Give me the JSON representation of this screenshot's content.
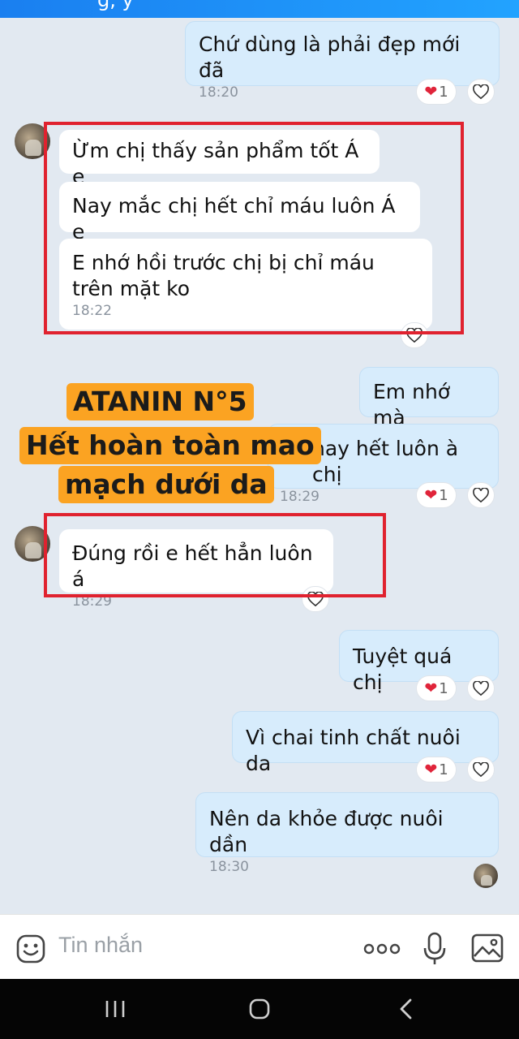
{
  "header": {
    "title_fragment": "g, y"
  },
  "messages": [
    {
      "text": "Chứ dùng là phải đẹp mới đã",
      "time": "18:20",
      "reaction_count": "1"
    },
    {
      "text": "Ừm chị thấy sản phẩm tốt Á e"
    },
    {
      "text": "Nay mắc chị hết chỉ máu luôn Á e"
    },
    {
      "text": "E nhớ hồi trước chị bị chỉ máu trên mặt ko",
      "time": "18:22"
    },
    {
      "text": "Em nhớ mà"
    },
    {
      "text": "nay hết luôn à chị",
      "time": "18:29",
      "reaction_count": "1"
    },
    {
      "text": "Đúng rồi e hết hẳn luôn á",
      "time": "18:29"
    },
    {
      "text": "Tuyệt quá chị",
      "reaction_count": "1"
    },
    {
      "text": "Vì chai tinh chất nuôi da",
      "reaction_count": "1"
    },
    {
      "text": "Nên da khỏe được nuôi dần",
      "time": "18:30"
    }
  ],
  "promo": {
    "line1": "ATANIN N°5",
    "line2": "Hết hoàn toàn mao",
    "line3": "mạch dưới da"
  },
  "composer": {
    "placeholder": "Tin nhắn"
  },
  "icons": {
    "emoji": "emoji-icon",
    "more": "more-icon",
    "mic": "microphone-icon",
    "image": "image-icon",
    "heart_filled": "heart-filled-icon",
    "heart_outline": "heart-outline-icon"
  },
  "colors": {
    "accent": "#1a7ff0",
    "outgoing_bubble": "#d7ecfc",
    "incoming_bubble": "#ffffff",
    "highlight": "#e0222f",
    "promo": "#fba322",
    "chat_background": "#e2e9f1"
  }
}
